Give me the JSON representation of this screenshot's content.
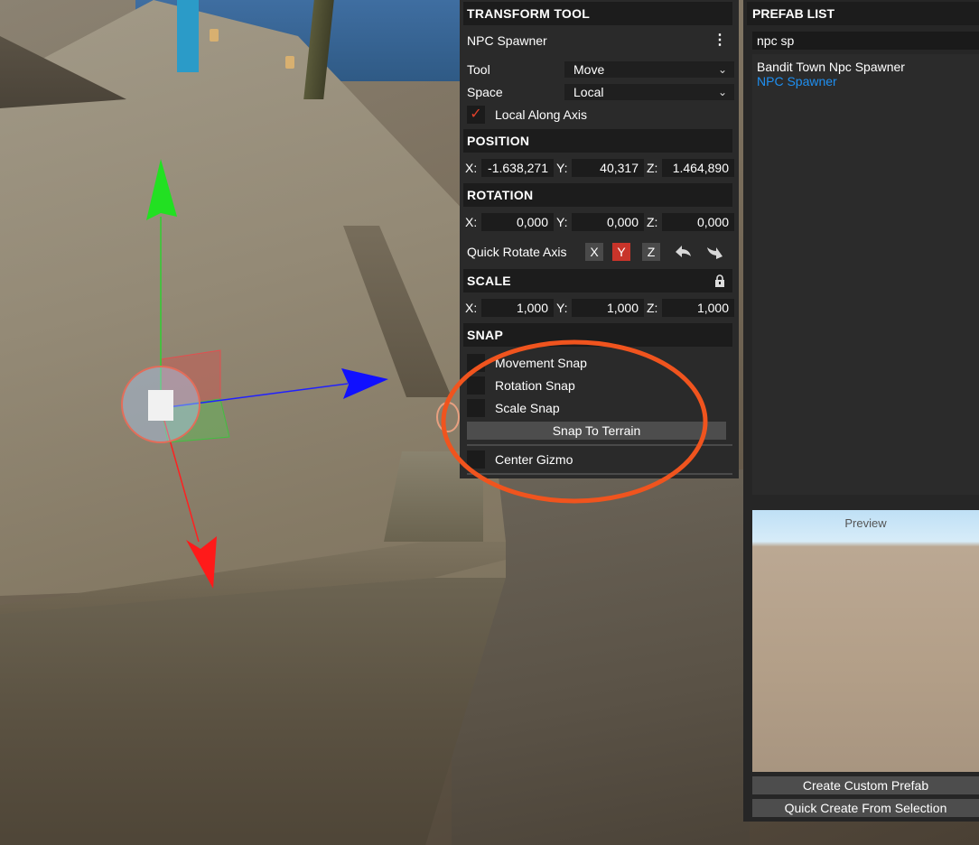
{
  "transform_tool": {
    "title": "TRANSFORM TOOL",
    "object_name": "NPC Spawner",
    "menu_icon": "vertical-dots-icon",
    "tool_label": "Tool",
    "tool_value": "Move",
    "space_label": "Space",
    "space_value": "Local",
    "local_along_axis_label": "Local Along Axis",
    "local_along_axis_checked": true,
    "position": {
      "title": "POSITION",
      "x_label": "X:",
      "x": "-1.638,271",
      "y_label": "Y:",
      "y": "40,317",
      "z_label": "Z:",
      "z": "1.464,890"
    },
    "rotation": {
      "title": "ROTATION",
      "x_label": "X:",
      "x": "0,000",
      "y_label": "Y:",
      "y": "0,000",
      "z_label": "Z:",
      "z": "0,000"
    },
    "quick_rotate": {
      "label": "Quick Rotate Axis",
      "x": "X",
      "y": "Y",
      "z": "Z",
      "active_axis": "Y"
    },
    "scale": {
      "title": "SCALE",
      "lock_icon": "lock-icon",
      "x_label": "X:",
      "x": "1,000",
      "y_label": "Y:",
      "y": "1,000",
      "z_label": "Z:",
      "z": "1,000"
    },
    "snap": {
      "title": "SNAP",
      "movement_snap": "Movement Snap",
      "rotation_snap": "Rotation Snap",
      "scale_snap": "Scale Snap",
      "snap_to_terrain": "Snap To Terrain",
      "center_gizmo": "Center Gizmo"
    }
  },
  "prefab_list": {
    "title": "PREFAB LIST",
    "search_value": "npc sp",
    "items": [
      {
        "label": "Bandit Town Npc Spawner",
        "selected": false
      },
      {
        "label": "NPC Spawner",
        "selected": true
      }
    ],
    "preview_label": "Preview",
    "create_custom_prefab": "Create Custom Prefab",
    "quick_create_from_selection": "Quick Create From Selection"
  },
  "colors": {
    "panel_bg": "#2a2a2a",
    "header_bg": "#1c1c1c",
    "selected_item": "#1f8ff0",
    "active_axis": "#c8342a",
    "annotation": "#f0541e",
    "gizmo_x": "#ff2020",
    "gizmo_y": "#20e020",
    "gizmo_z": "#1010ff"
  }
}
